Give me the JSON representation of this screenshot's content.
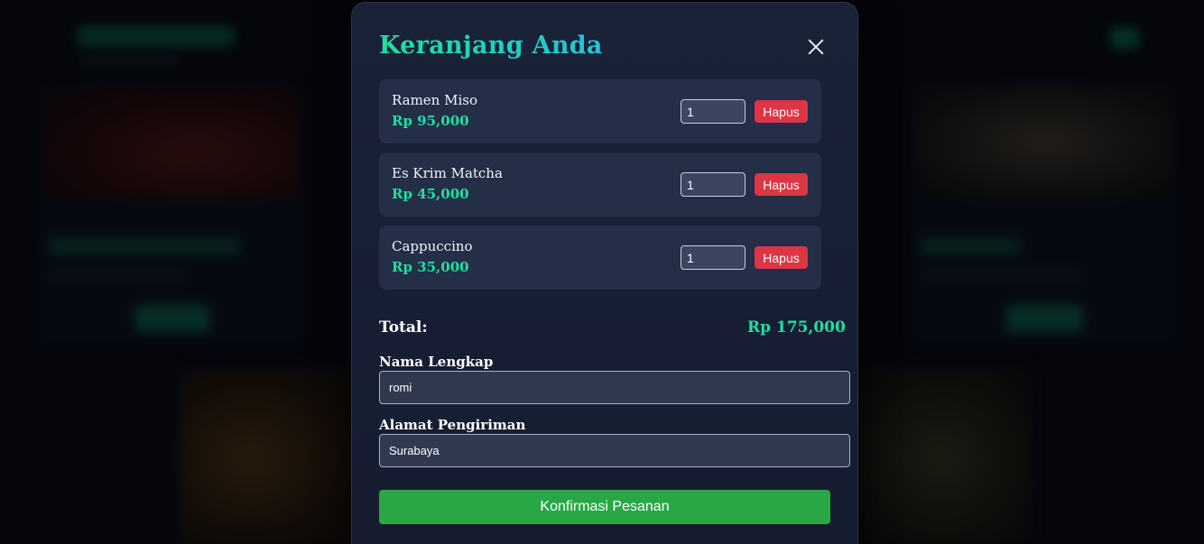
{
  "modal": {
    "title": "Keranjang Anda",
    "close_icon": "close-icon"
  },
  "cart": {
    "items": [
      {
        "name": "Ramen Miso",
        "price": "Rp 95,000",
        "quantity": "1",
        "remove_label": "Hapus"
      },
      {
        "name": "Es Krim Matcha",
        "price": "Rp 45,000",
        "quantity": "1",
        "remove_label": "Hapus"
      },
      {
        "name": "Cappuccino",
        "price": "Rp 35,000",
        "quantity": "1",
        "remove_label": "Hapus"
      }
    ],
    "total_label": "Total:",
    "total_value": "Rp 175,000"
  },
  "form": {
    "name_label": "Nama Lengkap",
    "name_value": "romi",
    "address_label": "Alamat Pengiriman",
    "address_value": "Surabaya",
    "confirm_label": "Konfirmasi Pesanan"
  },
  "colors": {
    "accent": "#1ee0a0",
    "danger": "#dc3545",
    "success": "#28a745",
    "modal_bg": "#1a2238"
  }
}
